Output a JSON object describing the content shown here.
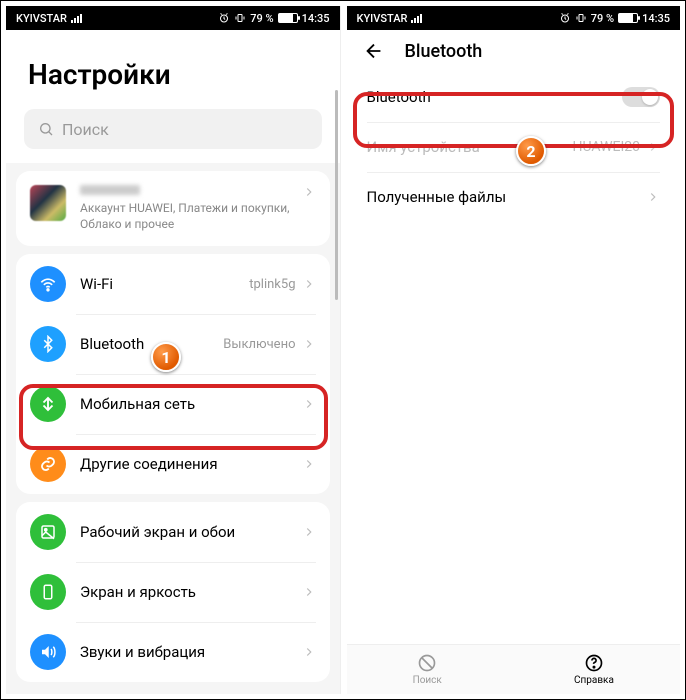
{
  "status": {
    "carrier": "KYIVSTAR",
    "battery": "79 %",
    "time": "14:35"
  },
  "left": {
    "title": "Настройки",
    "search_placeholder": "Поиск",
    "account_sub": "Аккаунт HUAWEI, Платежи и покупки, Облако и прочее",
    "rows": {
      "wifi": {
        "label": "Wi-Fi",
        "value": "tplink5g"
      },
      "bluetooth": {
        "label": "Bluetooth",
        "value": "Выключено"
      },
      "mobile": {
        "label": "Мобильная сеть"
      },
      "other": {
        "label": "Другие соединения"
      },
      "home": {
        "label": "Рабочий экран и обои"
      },
      "display": {
        "label": "Экран и яркость"
      },
      "sound": {
        "label": "Звуки и вибрация"
      }
    }
  },
  "right": {
    "title": "Bluetooth",
    "toggle_label": "Bluetooth",
    "device_name_label": "Имя устройства",
    "device_name_value": "HUAWEI20",
    "received_label": "Полученные файлы",
    "bottom": {
      "search": "Поиск",
      "help": "Справка"
    }
  },
  "annotations": {
    "step1": "1",
    "step2": "2"
  },
  "colors": {
    "wifi": "#1e90ff",
    "bluetooth": "#1ea0ff",
    "mobile": "#2fbf3a",
    "other": "#ff8c1a",
    "home": "#2fbf3a",
    "display": "#2fbf3a",
    "sound": "#1e90ff",
    "highlight": "#d62424"
  }
}
